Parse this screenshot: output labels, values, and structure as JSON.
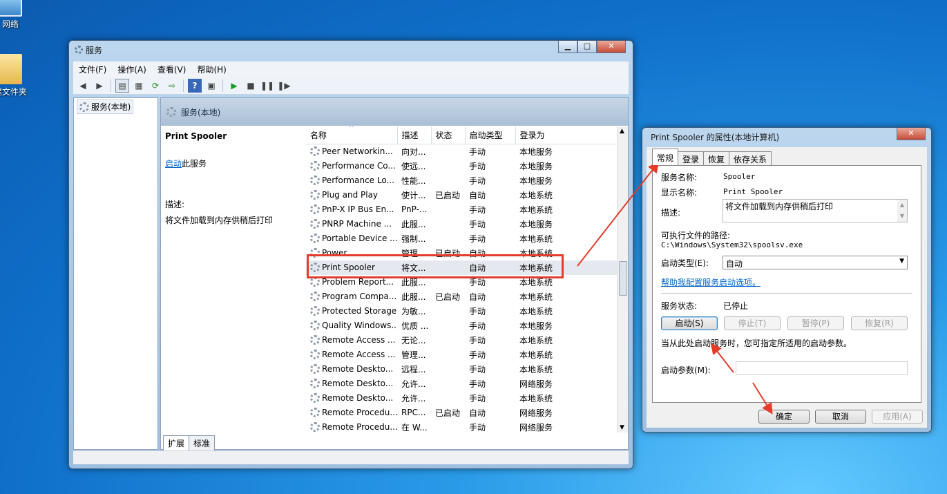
{
  "desktop": {
    "icon1_label": "网络",
    "icon2_label": "建文件夹"
  },
  "services_window": {
    "title": "服务",
    "menu": [
      "文件(F)",
      "操作(A)",
      "查看(V)",
      "帮助(H)"
    ],
    "tree_item": "服务(本地)",
    "header_title": "服务(本地)",
    "detail": {
      "service_name": "Print Spooler",
      "start_link": "启动",
      "start_suffix": "此服务",
      "desc_label": "描述:",
      "desc_text": "将文件加载到内存供稍后打印"
    },
    "columns": [
      "名称",
      "描述",
      "状态",
      "启动类型",
      "登录为"
    ],
    "rows": [
      [
        "Peer Networkin...",
        "向对...",
        "",
        "手动",
        "本地服务"
      ],
      [
        "Performance Co...",
        "使远...",
        "",
        "手动",
        "本地服务"
      ],
      [
        "Performance Lo...",
        "性能...",
        "",
        "手动",
        "本地服务"
      ],
      [
        "Plug and Play",
        "使计...",
        "已启动",
        "自动",
        "本地系统"
      ],
      [
        "PnP-X IP Bus En...",
        "PnP-...",
        "",
        "手动",
        "本地系统"
      ],
      [
        "PNRP Machine ...",
        "此服...",
        "",
        "手动",
        "本地服务"
      ],
      [
        "Portable Device ...",
        "强制...",
        "",
        "手动",
        "本地系统"
      ],
      [
        "Power",
        "管理...",
        "已启动",
        "自动",
        "本地系统"
      ],
      [
        "Print Spooler",
        "将文...",
        "",
        "自动",
        "本地系统"
      ],
      [
        "Problem Report...",
        "此服...",
        "",
        "手动",
        "本地系统"
      ],
      [
        "Program Compa...",
        "此服...",
        "已启动",
        "自动",
        "本地系统"
      ],
      [
        "Protected Storage",
        "为敏...",
        "",
        "手动",
        "本地系统"
      ],
      [
        "Quality Windows...",
        "优质 ...",
        "",
        "手动",
        "本地服务"
      ],
      [
        "Remote Access ...",
        "无论...",
        "",
        "手动",
        "本地系统"
      ],
      [
        "Remote Access ...",
        "管理...",
        "",
        "手动",
        "本地系统"
      ],
      [
        "Remote Deskto...",
        "远程...",
        "",
        "手动",
        "本地系统"
      ],
      [
        "Remote Deskto...",
        "允许...",
        "",
        "手动",
        "网络服务"
      ],
      [
        "Remote Deskto...",
        "允许...",
        "",
        "手动",
        "本地系统"
      ],
      [
        "Remote Procedu...",
        "RPC...",
        "已启动",
        "自动",
        "网络服务"
      ],
      [
        "Remote Procedu...",
        "在 W...",
        "",
        "手动",
        "网络服务"
      ]
    ],
    "selected_index": 8,
    "bottom_tabs": [
      "扩展",
      "标准"
    ]
  },
  "properties_dialog": {
    "title": "Print Spooler 的属性(本地计算机)",
    "tabs": [
      "常规",
      "登录",
      "恢复",
      "依存关系"
    ],
    "service_name_label": "服务名称:",
    "service_name": "Spooler",
    "display_name_label": "显示名称:",
    "display_name": "Print Spooler",
    "desc_label": "描述:",
    "desc": "将文件加载到内存供稍后打印",
    "path_label": "可执行文件的路径:",
    "path": "C:\\Windows\\System32\\spoolsv.exe",
    "startup_type_label": "启动类型(E):",
    "startup_type": "自动",
    "help_link": "帮助我配置服务启动选项。",
    "status_label": "服务状态:",
    "status": "已停止",
    "btn_start": "启动(S)",
    "btn_stop": "停止(T)",
    "btn_pause": "暂停(P)",
    "btn_resume": "恢复(R)",
    "hint": "当从此处启动服务时，您可指定所适用的启动参数。",
    "params_label": "启动参数(M):",
    "ok": "确定",
    "cancel": "取消",
    "apply": "应用(A)"
  },
  "colors": {
    "annotation": "#e43b2a",
    "link": "#0066cc"
  }
}
